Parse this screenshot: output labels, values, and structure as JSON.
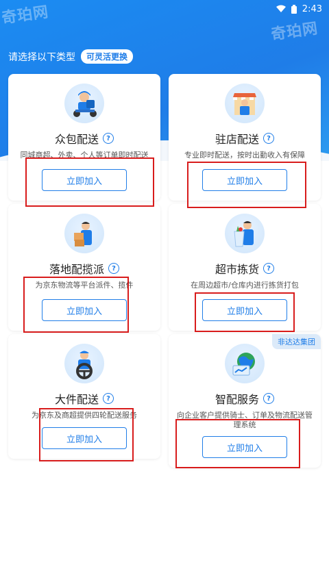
{
  "status_bar": {
    "time": "2:43"
  },
  "watermark": {
    "text": "奇珀网"
  },
  "heading": {
    "text": "请选择以下类型",
    "badge": "可灵活更换"
  },
  "colors": {
    "primary": "#1f7de8",
    "highlight": "#d81b1b"
  },
  "cards": [
    {
      "title": "众包配送",
      "desc": "同城商超、外卖、个人等订单即时配送",
      "button": "立即加入",
      "icon": "courier-scooter-icon"
    },
    {
      "title": "驻店配送",
      "desc": "专业即时配送，按时出勤收入有保障",
      "button": "立即加入",
      "icon": "storefront-courier-icon"
    },
    {
      "title": "落地配揽派",
      "desc": "为京东物流等平台派件、揽件",
      "button": "立即加入",
      "icon": "parcel-courier-icon"
    },
    {
      "title": "超市拣货",
      "desc": "在周边超市/仓库内进行拣货打包",
      "button": "立即加入",
      "icon": "grocery-bag-icon"
    },
    {
      "title": "大件配送",
      "desc": "为京东及商超提供四轮配送服务",
      "button": "立即加入",
      "icon": "driver-wheel-icon"
    },
    {
      "title": "智配服务",
      "desc": "向企业客户提供骑士、订单及物流配送管理系统",
      "button": "立即加入",
      "icon": "globe-network-icon",
      "tag": "非达达集团"
    }
  ]
}
